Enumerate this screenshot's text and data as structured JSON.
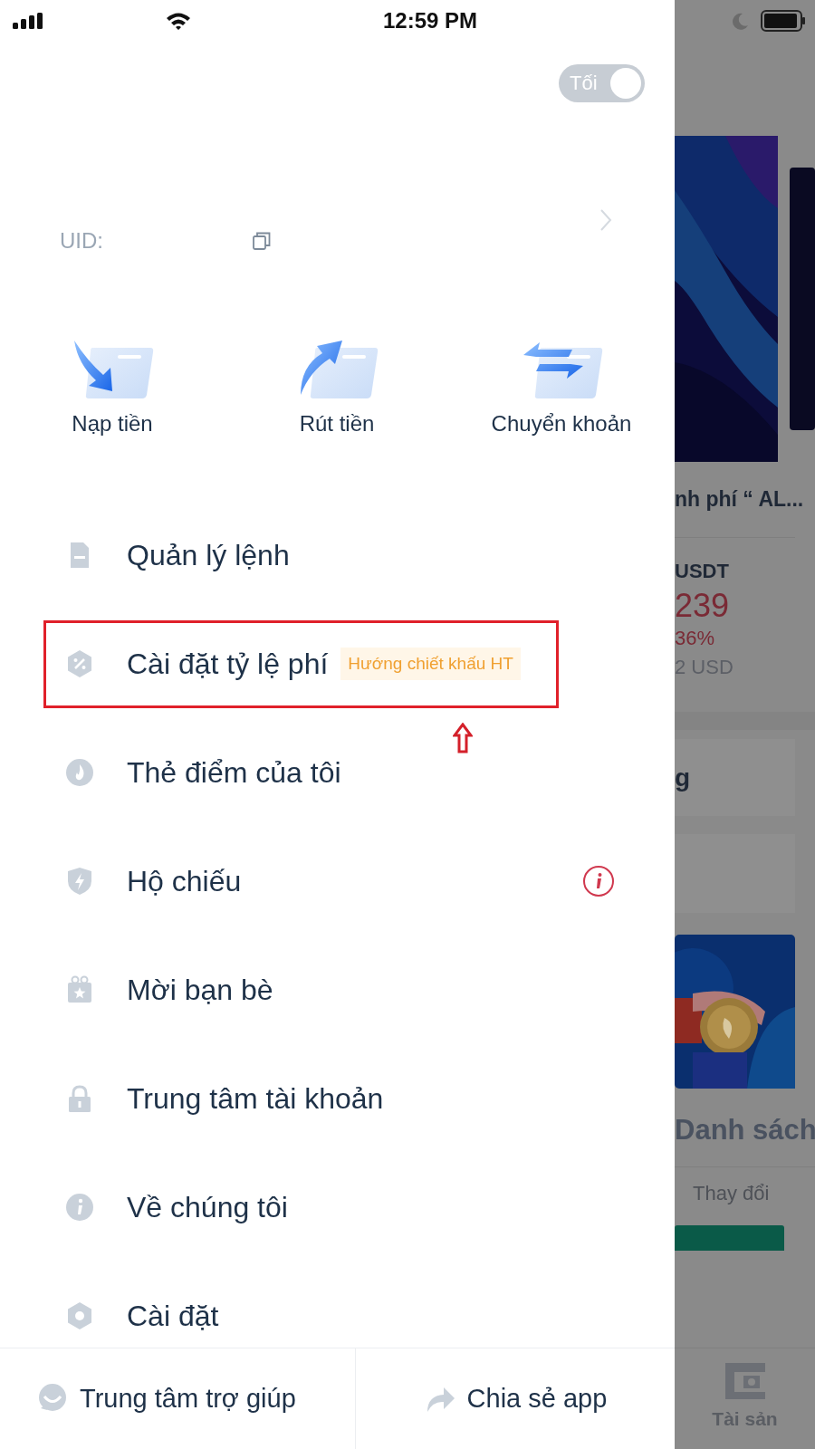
{
  "status_bar": {
    "time": "12:59 PM"
  },
  "theme_toggle": {
    "label": "Tối",
    "on": false
  },
  "profile": {
    "uid_label": "UID:"
  },
  "quick_actions": [
    {
      "label": "Nạp tiền"
    },
    {
      "label": "Rút tiền"
    },
    {
      "label": "Chuyển khoản"
    }
  ],
  "menu": [
    {
      "label": "Quản lý lệnh",
      "highlighted": false,
      "alert": false
    },
    {
      "label": "Cài đặt tỷ lệ phí",
      "badge": "Hướng chiết khấu HT",
      "highlighted": true,
      "alert": false
    },
    {
      "label": "Thẻ điểm của tôi",
      "highlighted": false,
      "alert": false
    },
    {
      "label": "Hộ chiếu",
      "highlighted": false,
      "alert": true
    },
    {
      "label": "Mời bạn bè",
      "highlighted": false,
      "alert": false
    },
    {
      "label": "Trung tâm tài khoản",
      "highlighted": false,
      "alert": false
    },
    {
      "label": "Về chúng tôi",
      "highlighted": false,
      "alert": false
    },
    {
      "label": "Cài đặt",
      "highlighted": false,
      "alert": false
    }
  ],
  "footer": [
    {
      "label": "Trung tâm trợ giúp"
    },
    {
      "label": "Chia sẻ app"
    }
  ],
  "background_page": {
    "banner_title": "nh phí “ AL...",
    "pair": "USDT",
    "price": "239",
    "change": "36%",
    "value": "2 USD",
    "card_title": "g",
    "section_title": "Danh sách",
    "column_label": "Thay đổi",
    "tab_label": "Tài sản"
  }
}
